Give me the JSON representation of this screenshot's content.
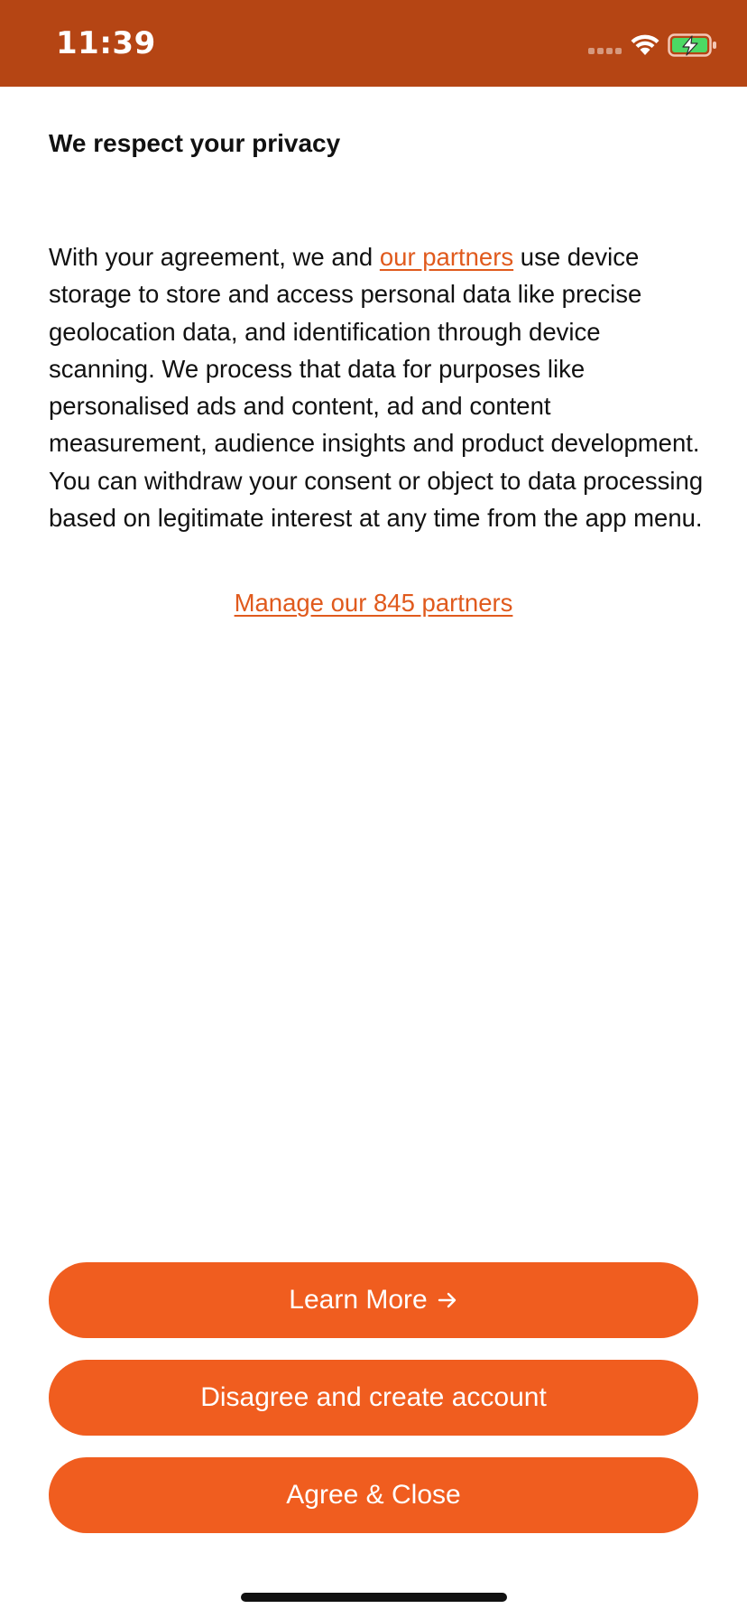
{
  "status_bar": {
    "time": "11:39"
  },
  "consent": {
    "title": "We respect your privacy",
    "body_prefix": "With your agreement, we and ",
    "partners_link": "our partners",
    "body_suffix": " use device storage to store and access personal data like precise geolocation data, and identification through device scanning. We process that data for purposes like personalised ads and content, ad and content measurement, audience insights and product development. You can withdraw your consent or object to data processing based on legitimate interest at any time from the app menu.",
    "manage_link": "Manage our 845 partners"
  },
  "buttons": {
    "learn_more": "Learn More",
    "learn_more_icon": "arrow-right-icon",
    "disagree": "Disagree and create account",
    "agree": "Agree & Close"
  },
  "colors": {
    "status_bar_bg": "#b54514",
    "accent": "#f05d1f",
    "link": "#e05a1d",
    "battery_fill": "#4cd964"
  }
}
